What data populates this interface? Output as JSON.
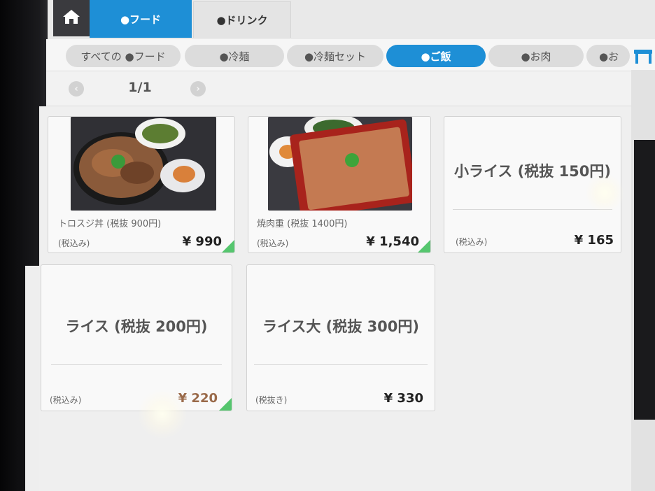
{
  "header": {
    "home_icon": "home-icon",
    "tabs": [
      {
        "label": "●フード",
        "active": true
      },
      {
        "label": "●ドリンク",
        "active": false
      }
    ]
  },
  "categories": [
    {
      "label": "すべての ●フード",
      "active": false
    },
    {
      "label": "●冷麺",
      "active": false
    },
    {
      "label": "●冷麺セット",
      "active": false
    },
    {
      "label": "●ご飯",
      "active": true
    },
    {
      "label": "●お肉",
      "active": false
    },
    {
      "label": "●お",
      "active": false
    }
  ],
  "pager": {
    "page": "1/1",
    "prev_icon": "chevron-left-icon",
    "next_icon": "chevron-right-icon"
  },
  "items": [
    {
      "name": "トロスジ丼 (税抜 900円)",
      "tax_label": "(税込み)",
      "price": "¥ 990",
      "has_photo": true
    },
    {
      "name": "焼肉重 (税抜 1400円)",
      "tax_label": "(税込み)",
      "price": "¥ 1,540",
      "has_photo": true
    },
    {
      "name": "小ライス (税抜 150円)",
      "tax_label": "(税込み)",
      "price": "¥ 165",
      "has_photo": false
    },
    {
      "name": "ライス (税抜 200円)",
      "tax_label": "(税込み)",
      "price": "¥ 220",
      "has_photo": false
    },
    {
      "name": "ライス大 (税抜 300円)",
      "tax_label": "(税抜き)",
      "price": "¥ 330",
      "has_photo": false
    }
  ],
  "colors": {
    "accent": "#1e8fd6",
    "corner_marker": "#55c66e"
  }
}
